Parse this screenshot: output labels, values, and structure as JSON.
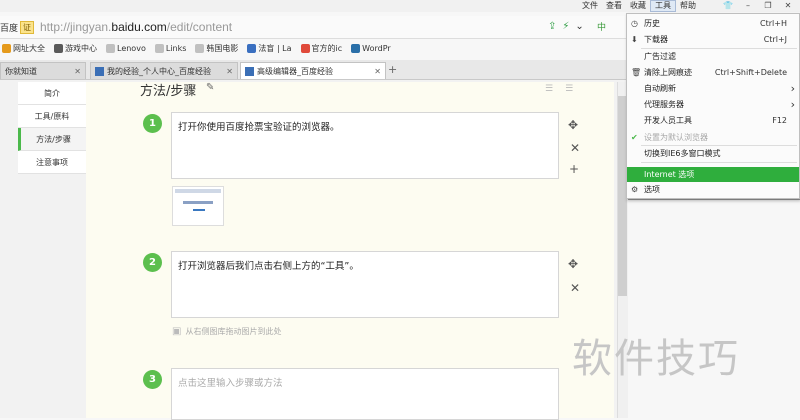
{
  "topmenu": [
    "文件",
    "查看",
    "收藏",
    "工具",
    "帮助"
  ],
  "winctl": [
    "👕",
    "–",
    "❐",
    "✕"
  ],
  "address": {
    "trust_label": "百度",
    "trust_badge": "证",
    "url_prefix": "http://jingyan.",
    "url_domain": "baidu.com",
    "url_suffix": "/edit/content",
    "search_engine": "中"
  },
  "bookmarks": [
    {
      "label": "网址大全",
      "color": "#e59a1c"
    },
    {
      "label": "游戏中心",
      "color": "#5a5a5a"
    },
    {
      "label": "Lenovo",
      "color": "#c0c0c0"
    },
    {
      "label": "Links",
      "color": "#c0c0c0"
    },
    {
      "label": "韩国电影",
      "color": "#c0c0c0"
    },
    {
      "label": "法盲 | La",
      "color": "#3a6fc0"
    },
    {
      "label": "官方的ic",
      "color": "#e04a3a"
    },
    {
      "label": "WordPr",
      "color": "#2a6fa8"
    }
  ],
  "tabs": [
    {
      "label": "你就知道"
    },
    {
      "label": "我的经验_个人中心_百度经验"
    },
    {
      "label": "高级编辑器_百度经验"
    }
  ],
  "sidenav": [
    "简介",
    "工具/原料",
    "方法/步骤",
    "注意事项"
  ],
  "section_title": "方法/步骤",
  "steps": [
    {
      "num": "1",
      "text": "打开你使用百度抢票宝验证的浏览器。"
    },
    {
      "num": "2",
      "text": "打开浏览器后我们点击右侧上方的“工具”。"
    },
    {
      "num": "3",
      "text": "点击这里输入步骤或方法"
    }
  ],
  "drop_hint": "从右侧图库拖动图片到此处",
  "tools_menu": [
    {
      "label": "历史",
      "shortcut": "Ctrl+H",
      "icon": "clock-icon",
      "glyph": "◷"
    },
    {
      "label": "下载器",
      "shortcut": "Ctrl+J",
      "icon": "download-icon",
      "glyph": "⬇"
    },
    {
      "label": "广告过滤",
      "shortcut": "",
      "icon": "",
      "glyph": ""
    },
    {
      "label": "清除上网痕迹",
      "shortcut": "Ctrl+Shift+Delete",
      "icon": "trash-icon",
      "glyph": "🗑"
    },
    {
      "label": "自动刷新",
      "shortcut": "›",
      "icon": "",
      "glyph": ""
    },
    {
      "label": "代理服务器",
      "shortcut": "›",
      "icon": "",
      "glyph": ""
    },
    {
      "label": "开发人员工具",
      "shortcut": "F12",
      "icon": "",
      "glyph": ""
    },
    {
      "label": "设置为默认浏览器",
      "shortcut": "",
      "icon": "check-icon",
      "glyph": "✔"
    },
    {
      "label": "切换到IE6多窗口模式",
      "shortcut": "",
      "icon": "",
      "glyph": ""
    },
    {
      "label": "Internet 选项",
      "shortcut": "",
      "icon": "",
      "glyph": ""
    },
    {
      "label": "选项",
      "shortcut": "",
      "icon": "gear-icon",
      "glyph": "⚙"
    }
  ],
  "watermark": "软件技巧",
  "colors": {
    "accent_green": "#5cbf4e",
    "menu_highlight": "#2fae3d"
  }
}
